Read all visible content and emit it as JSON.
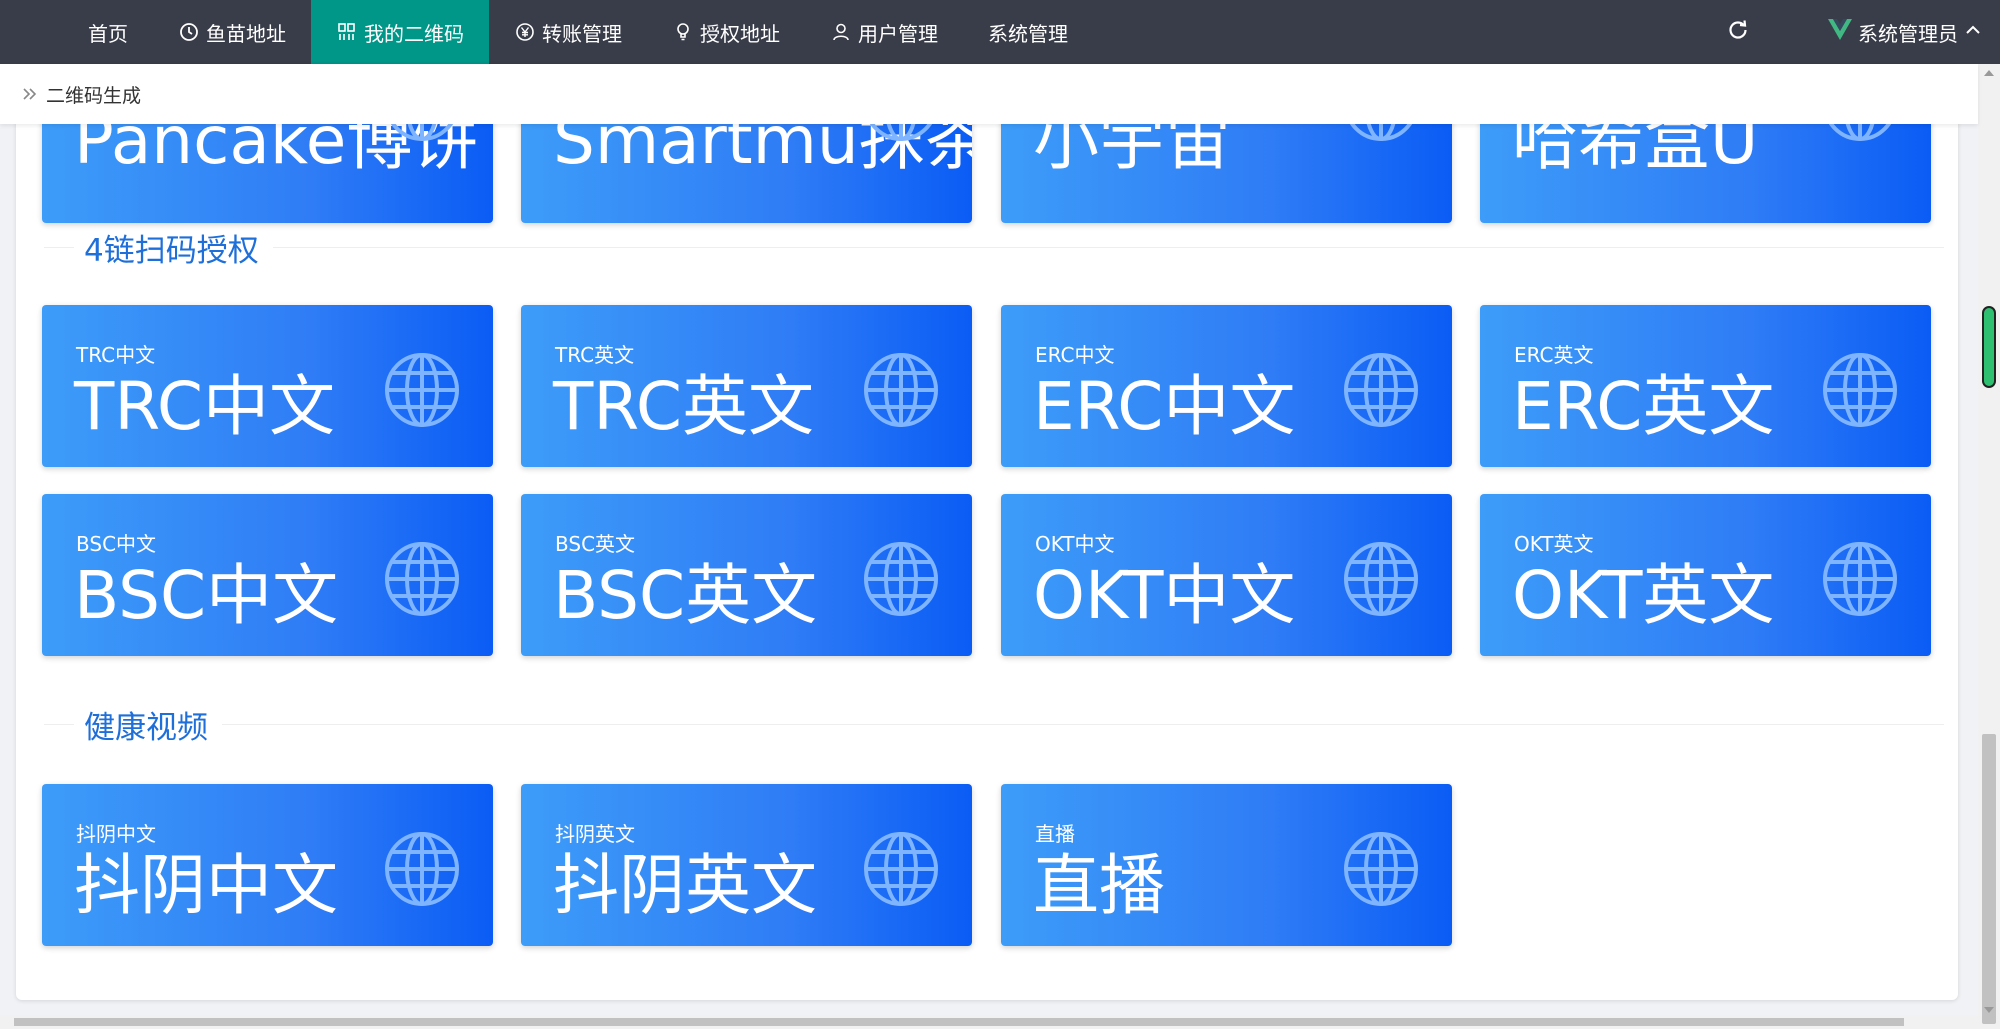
{
  "nav": {
    "items": [
      {
        "label": "首页",
        "icon": "none"
      },
      {
        "label": "鱼苗地址",
        "icon": "clock-icon"
      },
      {
        "label": "我的二维码",
        "icon": "qrcode-icon",
        "active": true
      },
      {
        "label": "转账管理",
        "icon": "yen-icon"
      },
      {
        "label": "授权地址",
        "icon": "bulb-icon"
      },
      {
        "label": "用户管理",
        "icon": "user-icon"
      },
      {
        "label": "系统管理",
        "icon": "none"
      }
    ],
    "user_label": "系统管理员",
    "active_color": "#009688",
    "bar_color": "#393d49"
  },
  "breadcrumb": {
    "current": "二维码生成"
  },
  "partial_row": [
    {
      "big": "Pancake博饼"
    },
    {
      "big": "Smartmu抹茶"
    },
    {
      "big": "小宇宙"
    },
    {
      "big": "哈希盒U"
    }
  ],
  "sections": [
    {
      "title": "4链扫码授权",
      "cards": [
        {
          "small": "TRC中文",
          "big": "TRC中文"
        },
        {
          "small": "TRC英文",
          "big": "TRC英文"
        },
        {
          "small": "ERC中文",
          "big": "ERC中文"
        },
        {
          "small": "ERC英文",
          "big": "ERC英文"
        },
        {
          "small": "BSC中文",
          "big": "BSC中文"
        },
        {
          "small": "BSC英文",
          "big": "BSC英文"
        },
        {
          "small": "OKT中文",
          "big": "OKT中文"
        },
        {
          "small": "OKT英文",
          "big": "OKT英文"
        }
      ]
    },
    {
      "title": "健康视频",
      "cards": [
        {
          "small": "抖阴中文",
          "big": "抖阴中文"
        },
        {
          "small": "抖阴英文",
          "big": "抖阴英文"
        },
        {
          "small": "直播",
          "big": "直播"
        }
      ]
    }
  ]
}
